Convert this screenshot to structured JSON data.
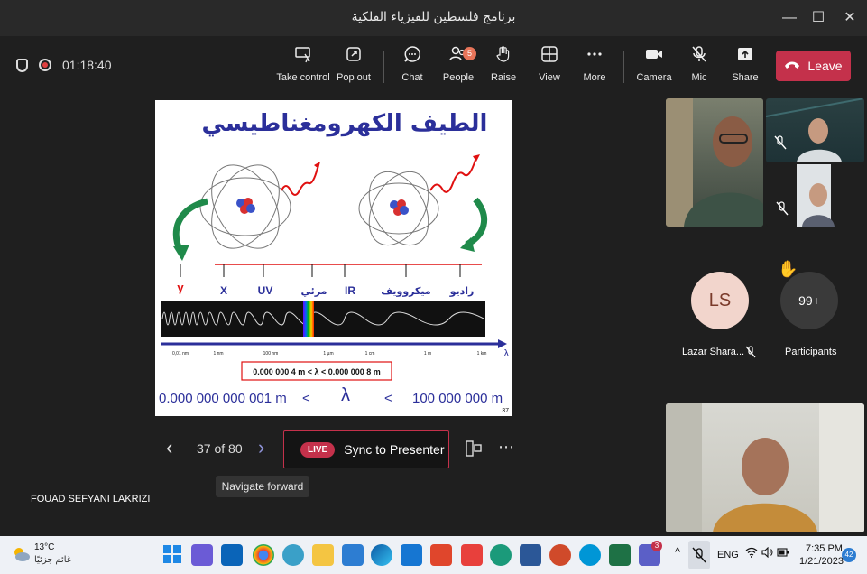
{
  "window": {
    "title": "برنامج فلسطين للفيزياء الفلكية",
    "controls": [
      "—",
      "☐",
      "✕"
    ]
  },
  "meeting": {
    "timer": "01:18:40"
  },
  "toolbar": {
    "take_control": "Take control",
    "pop_out": "Pop out",
    "chat": "Chat",
    "people": "People",
    "people_badge": "5",
    "raise": "Raise",
    "view": "View",
    "more": "More",
    "camera": "Camera",
    "mic": "Mic",
    "share": "Share",
    "leave": "Leave"
  },
  "slide": {
    "title": "الطيف الكهرومغناطيسي",
    "bands": [
      "γ",
      "X",
      "UV",
      "مرئي",
      "IR",
      "ميكروويف",
      "راديو"
    ],
    "scale_ticks": [
      "0,01 nm",
      "1 nm",
      "100 nm",
      "1 µm",
      "1 cm",
      "1 m",
      "1 km"
    ],
    "axis_symbol": "λ",
    "visible_range": "0.000 000 4 m < λ < 0.000 000 8 m",
    "full_range_left": "0.000 000 000 001 m",
    "full_range_lt1": "<",
    "full_range_lambda": "λ",
    "full_range_lt2": "<",
    "full_range_right": "100 000 000 m",
    "page_number": "37"
  },
  "nav": {
    "page": "37 of 80",
    "live_label": "LIVE",
    "sync_label": "Sync to Presenter",
    "tooltip": "Navigate forward"
  },
  "presenter_name": "FOUAD SEFYANI LAKRIZI",
  "participants": {
    "ls_initials": "LS",
    "ls_name": "Lazar Shara...",
    "count": "99+",
    "count_label": "Participants",
    "raise_emoji": "✋"
  },
  "taskbar": {
    "weather_temp": "13°C",
    "weather_text": "غائم جزئيًا",
    "lang": "ENG",
    "time": "7:35 PM",
    "date": "1/21/2023",
    "notifications": "42",
    "teams_badge": "3"
  },
  "colors": {
    "leave": "#c4314b",
    "ls_avatar_bg": "#f2d5cc",
    "ls_avatar_text": "#7a3a2a",
    "accent": "#6264a7"
  }
}
